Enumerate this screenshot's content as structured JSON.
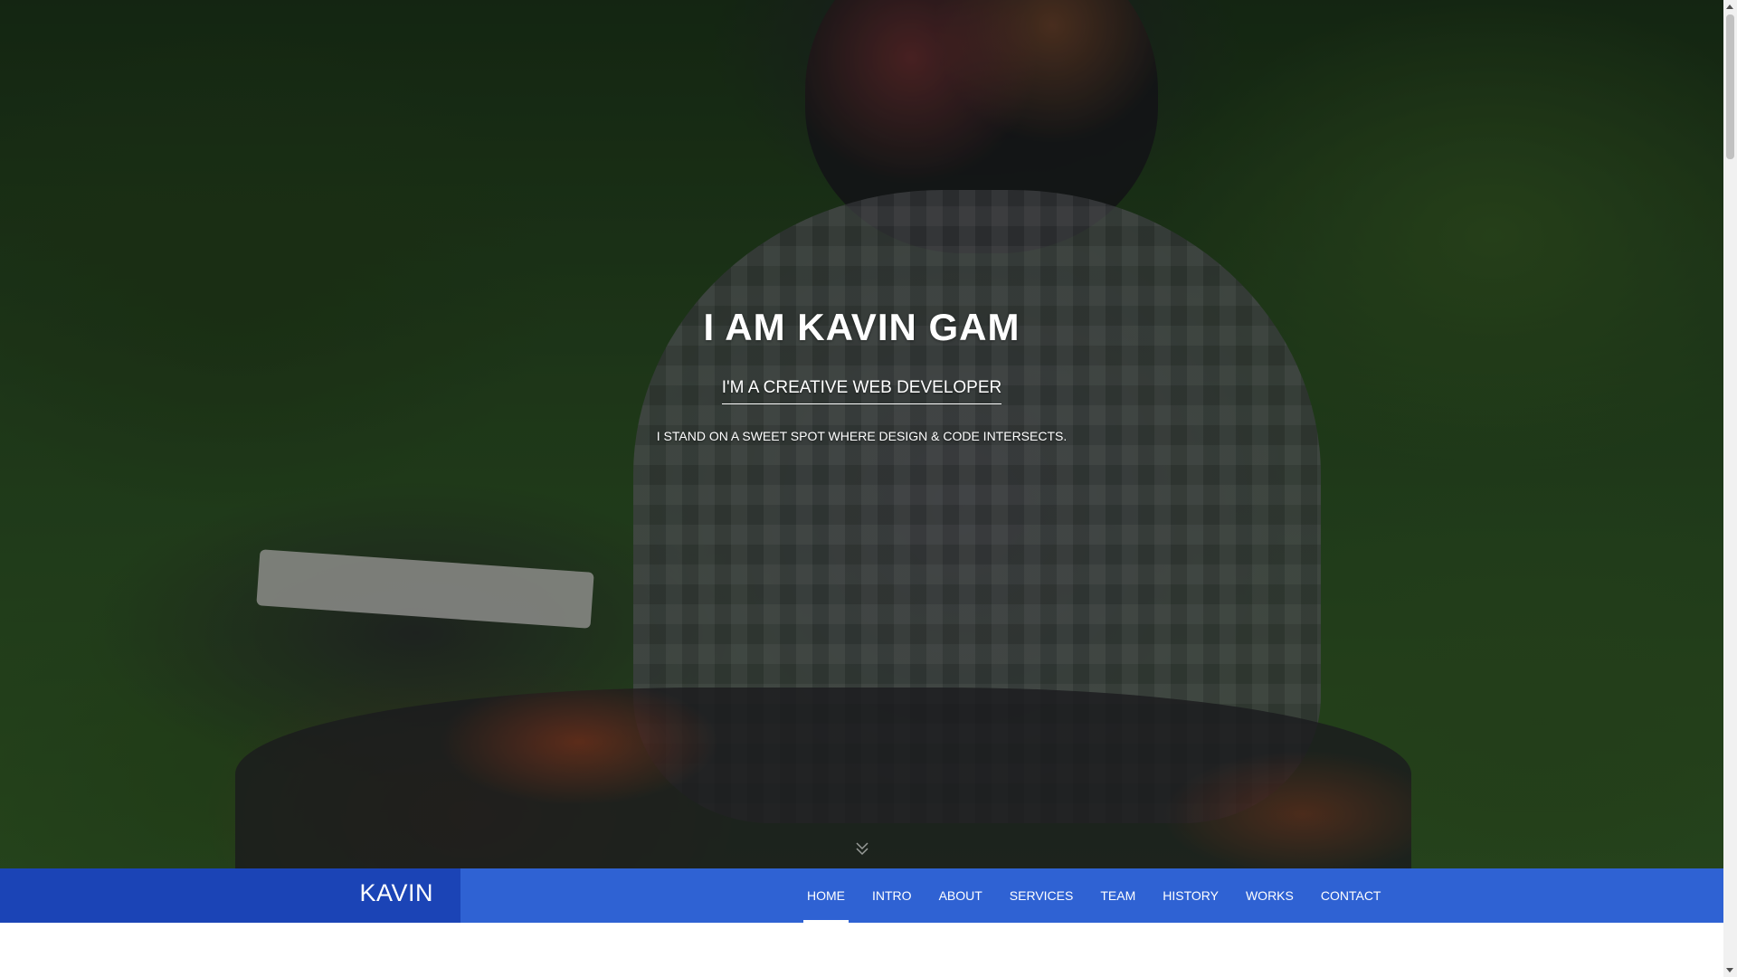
{
  "hero": {
    "title": "I AM KAVIN GAM",
    "subtitle": "I'M A CREATIVE WEB DEVELOPER",
    "tagline": "I STAND ON A SWEET SPOT WHERE DESIGN & CODE INTERSECTS.",
    "scroll_icon": "double-chevron-down-icon"
  },
  "navbar": {
    "brand": "KAVIN",
    "links": [
      {
        "label": "HOME",
        "active": true
      },
      {
        "label": "INTRO",
        "active": false
      },
      {
        "label": "ABOUT",
        "active": false
      },
      {
        "label": "SERVICES",
        "active": false
      },
      {
        "label": "TEAM",
        "active": false
      },
      {
        "label": "HISTORY",
        "active": false
      },
      {
        "label": "WORKS",
        "active": false
      },
      {
        "label": "CONTACT",
        "active": false
      }
    ]
  },
  "colors": {
    "navbar": "#2f62d3",
    "brand_block": "#1b44b6",
    "text": "#ffffff"
  }
}
